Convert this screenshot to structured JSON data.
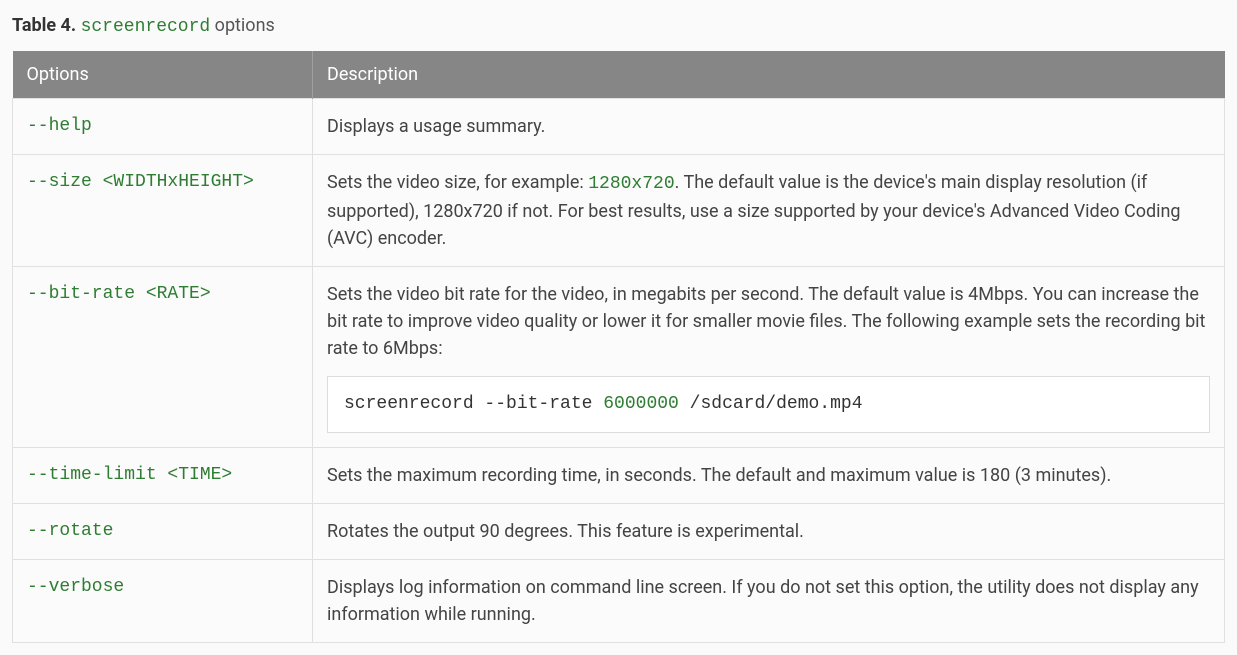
{
  "caption": {
    "bold": "Table 4.",
    "code": "screenrecord",
    "suffix": "options"
  },
  "headers": {
    "options": "Options",
    "description": "Description"
  },
  "rows": {
    "help": {
      "option": "--help",
      "desc": "Displays a usage summary."
    },
    "size": {
      "option": "--size <WIDTHxHEIGHT>",
      "desc_a": "Sets the video size, for example: ",
      "desc_code": "1280x720",
      "desc_b": ". The default value is the device's main display resolution (if supported), 1280x720 if not. For best results, use a size supported by your device's Advanced Video Coding (AVC) encoder."
    },
    "bitrate": {
      "option": "--bit-rate <RATE>",
      "desc": "Sets the video bit rate for the video, in megabits per second. The default value is 4Mbps. You can increase the bit rate to improve video quality or lower it for smaller movie files. The following example sets the recording bit rate to 6Mbps:",
      "code_a": "screenrecord --bit-rate ",
      "code_num": "6000000",
      "code_b": " /sdcard/demo.mp4"
    },
    "timelimit": {
      "option": "--time-limit <TIME>",
      "desc": "Sets the maximum recording time, in seconds. The default and maximum value is 180 (3 minutes)."
    },
    "rotate": {
      "option": "--rotate",
      "desc": "Rotates the output 90 degrees. This feature is experimental."
    },
    "verbose": {
      "option": "--verbose",
      "desc": "Displays log information on command line screen. If you do not set this option, the utility does not display any information while running."
    }
  }
}
